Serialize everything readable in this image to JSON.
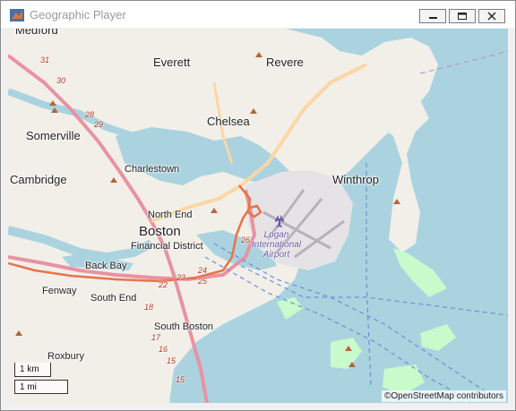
{
  "window": {
    "title": "Geographic Player"
  },
  "title_bar_buttons": {
    "minimize": "minimize-icon",
    "maximize": "maximize-icon",
    "close": "close-icon"
  },
  "map": {
    "places": {
      "medford": "Medford",
      "everett": "Everett",
      "revere": "Revere",
      "chelsea": "Chelsea",
      "somerville": "Somerville",
      "charlestown": "Charlestown",
      "cambridge": "Cambridge",
      "winthrop": "Winthrop",
      "north_end": "North End",
      "boston": "Boston",
      "financial_district": "Financial District",
      "back_bay": "Back Bay",
      "fenway": "Fenway",
      "south_end": "South End",
      "south_boston": "South Boston",
      "roxbury": "Roxbury"
    },
    "airport": {
      "line1": "Logan",
      "line2": "International",
      "line3": "Airport"
    },
    "road_numbers": {
      "r31": "31",
      "r30": "30",
      "r28": "28",
      "r29": "29",
      "r26": "26",
      "r24": "24",
      "r25": "25",
      "r23": "23",
      "r22": "22",
      "r18": "18",
      "r17": "17",
      "r16": "16",
      "r15": "15",
      "r15b": "15"
    },
    "scale": {
      "km": "1 km",
      "mi": "1 mi"
    },
    "attribution": "©OpenStreetMap contributors",
    "colors": {
      "water": "#aad3df",
      "land": "#f2efe9",
      "route": "#e8734a",
      "motorway": "#e892a2",
      "park": "#c8facc"
    }
  }
}
